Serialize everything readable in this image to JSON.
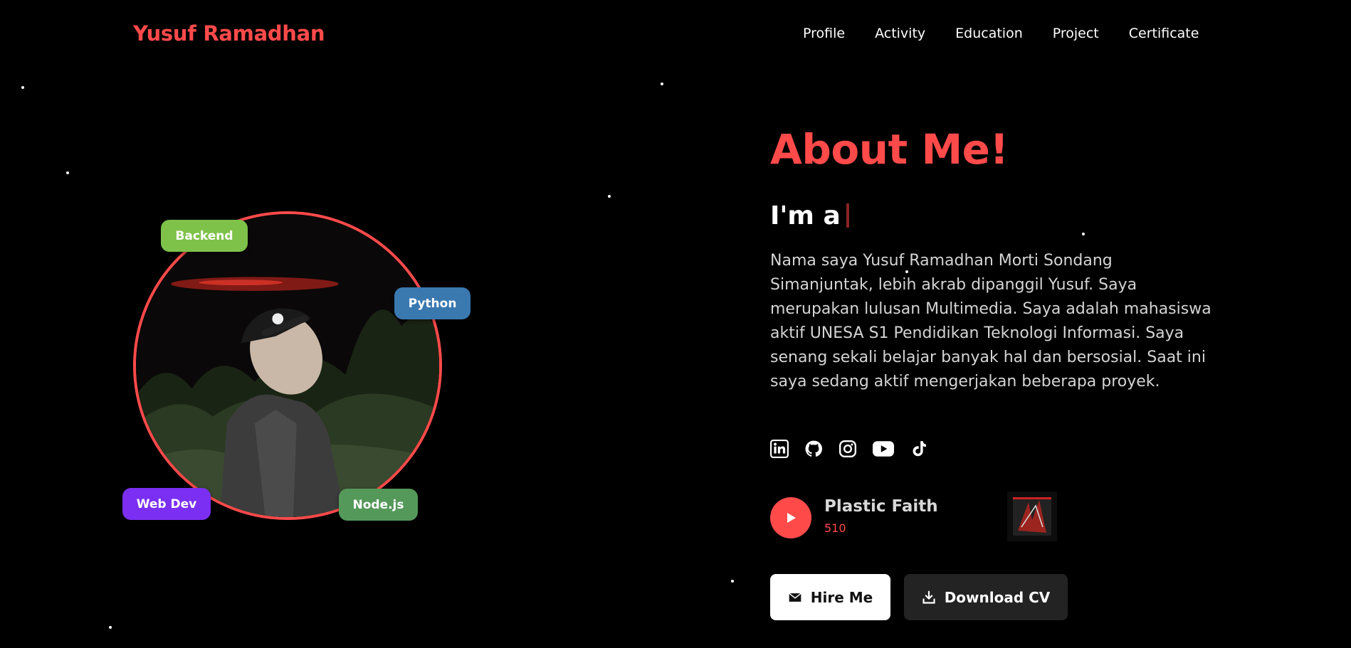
{
  "brand": "Yusuf Ramadhan",
  "nav": [
    {
      "label": "Profile"
    },
    {
      "label": "Activity"
    },
    {
      "label": "Education"
    },
    {
      "label": "Project"
    },
    {
      "label": "Certificate"
    }
  ],
  "tags": {
    "backend": "Backend",
    "python": "Python",
    "webdev": "Web Dev",
    "node": "Node.js"
  },
  "about": {
    "title": "About Me!",
    "im_a": "I'm a",
    "bio": "Nama saya Yusuf Ramadhan Morti Sondang Simanjuntak, lebih akrab dipanggil Yusuf. Saya merupakan lulusan Multimedia. Saya adalah mahasiswa aktif UNESA S1 Pendidikan Teknologi Informasi. Saya senang sekali belajar banyak hal dan bersosial. Saat ini saya sedang aktif mengerjakan beberapa proyek."
  },
  "socials": [
    "linkedin-icon",
    "github-icon",
    "instagram-icon",
    "youtube-icon",
    "tiktok-icon"
  ],
  "player": {
    "title": "Plastic Faith",
    "artist": "510"
  },
  "buttons": {
    "hire": "Hire Me",
    "cv": "Download CV"
  },
  "colors": {
    "accent": "#ff4a4a",
    "background": "#000000"
  }
}
